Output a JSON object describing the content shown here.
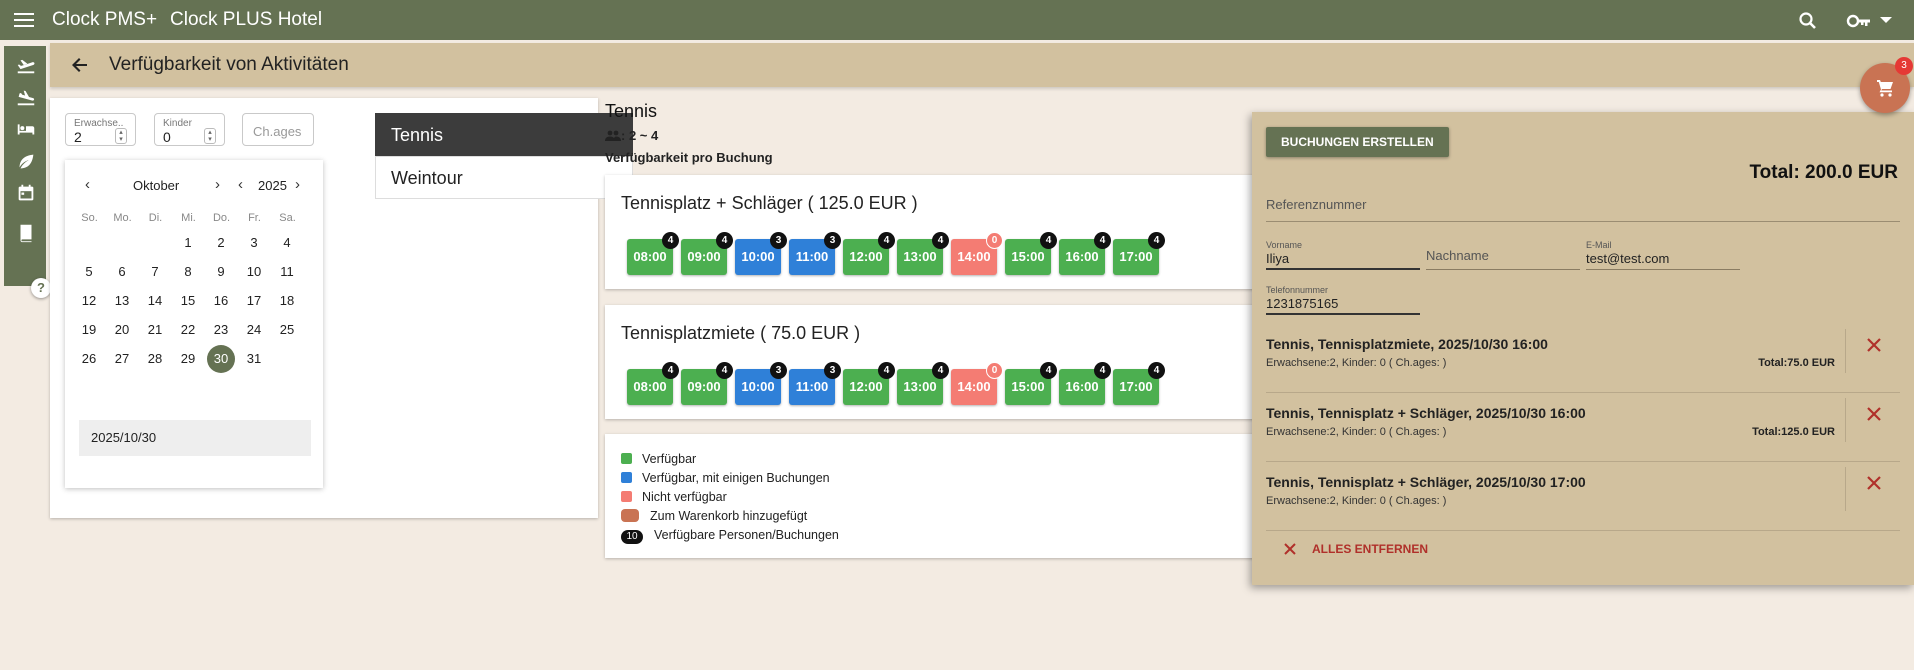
{
  "app": {
    "name": "Clock PMS+",
    "hotel": "Clock PLUS Hotel"
  },
  "page": {
    "title": "Verfügbarkeit von Aktivitäten"
  },
  "filters": {
    "adults": {
      "label": "Erwachse..",
      "value": "2"
    },
    "children": {
      "label": "Kinder",
      "value": "0"
    },
    "ch_ages": {
      "placeholder": "Ch.ages"
    }
  },
  "calendar": {
    "month": "Oktober",
    "year": "2025",
    "weekdays": [
      "So.",
      "Mo.",
      "Di.",
      "Mi.",
      "Do.",
      "Fr.",
      "Sa."
    ],
    "selected_day": "30",
    "selected_date": "2025/10/30"
  },
  "activities": [
    "Tennis",
    "Weintour"
  ],
  "selected_activity": {
    "title": "Tennis",
    "persons": ": 2 ~ 4",
    "per_booking_label": "Verfügbarkeit pro Buchung"
  },
  "colors": {
    "green": "#4caf50",
    "blue": "#2f80d8",
    "red": "#f47c73",
    "brand": "#657253",
    "cart": "#c97353"
  },
  "offers": [
    {
      "title": "Tennisplatz + Schläger ( 125.0 EUR )",
      "slots": [
        {
          "time": "08:00",
          "count": "4",
          "status": "green"
        },
        {
          "time": "09:00",
          "count": "4",
          "status": "green"
        },
        {
          "time": "10:00",
          "count": "3",
          "status": "blue"
        },
        {
          "time": "11:00",
          "count": "3",
          "status": "blue"
        },
        {
          "time": "12:00",
          "count": "4",
          "status": "green"
        },
        {
          "time": "13:00",
          "count": "4",
          "status": "green"
        },
        {
          "time": "14:00",
          "count": "0",
          "status": "red"
        },
        {
          "time": "15:00",
          "count": "4",
          "status": "green"
        },
        {
          "time": "16:00",
          "count": "4",
          "status": "green"
        },
        {
          "time": "17:00",
          "count": "4",
          "status": "green"
        }
      ]
    },
    {
      "title": "Tennisplatzmiete ( 75.0 EUR )",
      "slots": [
        {
          "time": "08:00",
          "count": "4",
          "status": "green"
        },
        {
          "time": "09:00",
          "count": "4",
          "status": "green"
        },
        {
          "time": "10:00",
          "count": "3",
          "status": "blue"
        },
        {
          "time": "11:00",
          "count": "3",
          "status": "blue"
        },
        {
          "time": "12:00",
          "count": "4",
          "status": "green"
        },
        {
          "time": "13:00",
          "count": "4",
          "status": "green"
        },
        {
          "time": "14:00",
          "count": "0",
          "status": "red"
        },
        {
          "time": "15:00",
          "count": "4",
          "status": "green"
        },
        {
          "time": "16:00",
          "count": "4",
          "status": "green"
        },
        {
          "time": "17:00",
          "count": "4",
          "status": "green"
        }
      ]
    }
  ],
  "legend": {
    "available": "Verfügbar",
    "partial": "Verfügbar, mit einigen Buchungen",
    "unavailable": "Nicht verfügbar",
    "in_cart": "Zum Warenkorb hinzugefügt",
    "count_badge": "10",
    "count": "Verfügbare Personen/Buchungen"
  },
  "cart": {
    "create_button": "BUCHUNGEN ERSTELLEN",
    "total": "Total: 200.0 EUR",
    "reference_placeholder": "Referenznummer",
    "firstname": {
      "label": "Vorname",
      "value": "Iliya"
    },
    "lastname": {
      "placeholder": "Nachname"
    },
    "email": {
      "label": "E-Mail",
      "value": "test@test.com"
    },
    "phone": {
      "label": "Telefonnummer",
      "value": "1231875165"
    },
    "items": [
      {
        "title": "Tennis, Tennisplatzmiete, 2025/10/30 16:00",
        "details": "Erwachsene:2, Kinder: 0 ( Ch.ages: )",
        "total": "Total:75.0 EUR"
      },
      {
        "title": "Tennis, Tennisplatz + Schläger, 2025/10/30 16:00",
        "details": "Erwachsene:2, Kinder: 0 ( Ch.ages: )",
        "total": "Total:125.0 EUR"
      },
      {
        "title": "Tennis, Tennisplatz + Schläger, 2025/10/30 17:00",
        "details": "Erwachsene:2, Kinder: 0 ( Ch.ages: )",
        "total": ""
      }
    ],
    "remove_all": "ALLES ENTFERNEN",
    "badge_count": "3"
  }
}
